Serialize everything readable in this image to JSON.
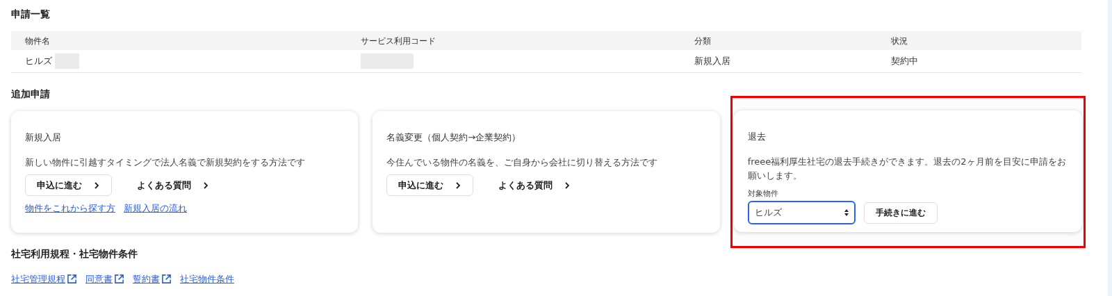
{
  "applications": {
    "title": "申請一覧",
    "table": {
      "columns": [
        "物件名",
        "サービス利用コード",
        "分類",
        "状況"
      ],
      "rows": [
        {
          "cells": [
            {
              "text": "ヒルズ",
              "redacted": true
            },
            {
              "redacted": true
            },
            {
              "text": "新規入居"
            },
            {
              "text": "契約中"
            }
          ]
        }
      ]
    }
  },
  "additional": {
    "title": "追加申請",
    "cards": [
      {
        "kind": "apply",
        "title": "新規入居",
        "description": "新しい物件に引越すタイミングで法人名義で新規契約をする方法です",
        "apply_button": "申込に進む",
        "faq_link": "よくある質問",
        "links": [
          "物件をこれから探す方",
          "新規入居の流れ"
        ]
      },
      {
        "kind": "apply",
        "title": "名義変更（個人契約→企業契約）",
        "description": "今住んでいる物件の名義を、ご自身から会社に切り替える方法です",
        "apply_button": "申込に進む",
        "faq_link": "よくある質問"
      },
      {
        "kind": "moveout",
        "highlighted": true,
        "title": "退去",
        "description": "freee福利厚生社宅の退去手続きができます。退去の2ヶ月前を目安に申請をお願いします。",
        "select_label": "対象物件",
        "select_value": "ヒルズ",
        "proceed_button": "手続きに進む"
      }
    ]
  },
  "rules": {
    "title": "社宅利用規程・社宅物件条件",
    "links": [
      {
        "text": "社宅管理規程",
        "external": true
      },
      {
        "text": "同意書",
        "external": true
      },
      {
        "text": "誓約書",
        "external": true
      },
      {
        "text": "社宅物件条件",
        "external": false
      }
    ]
  }
}
